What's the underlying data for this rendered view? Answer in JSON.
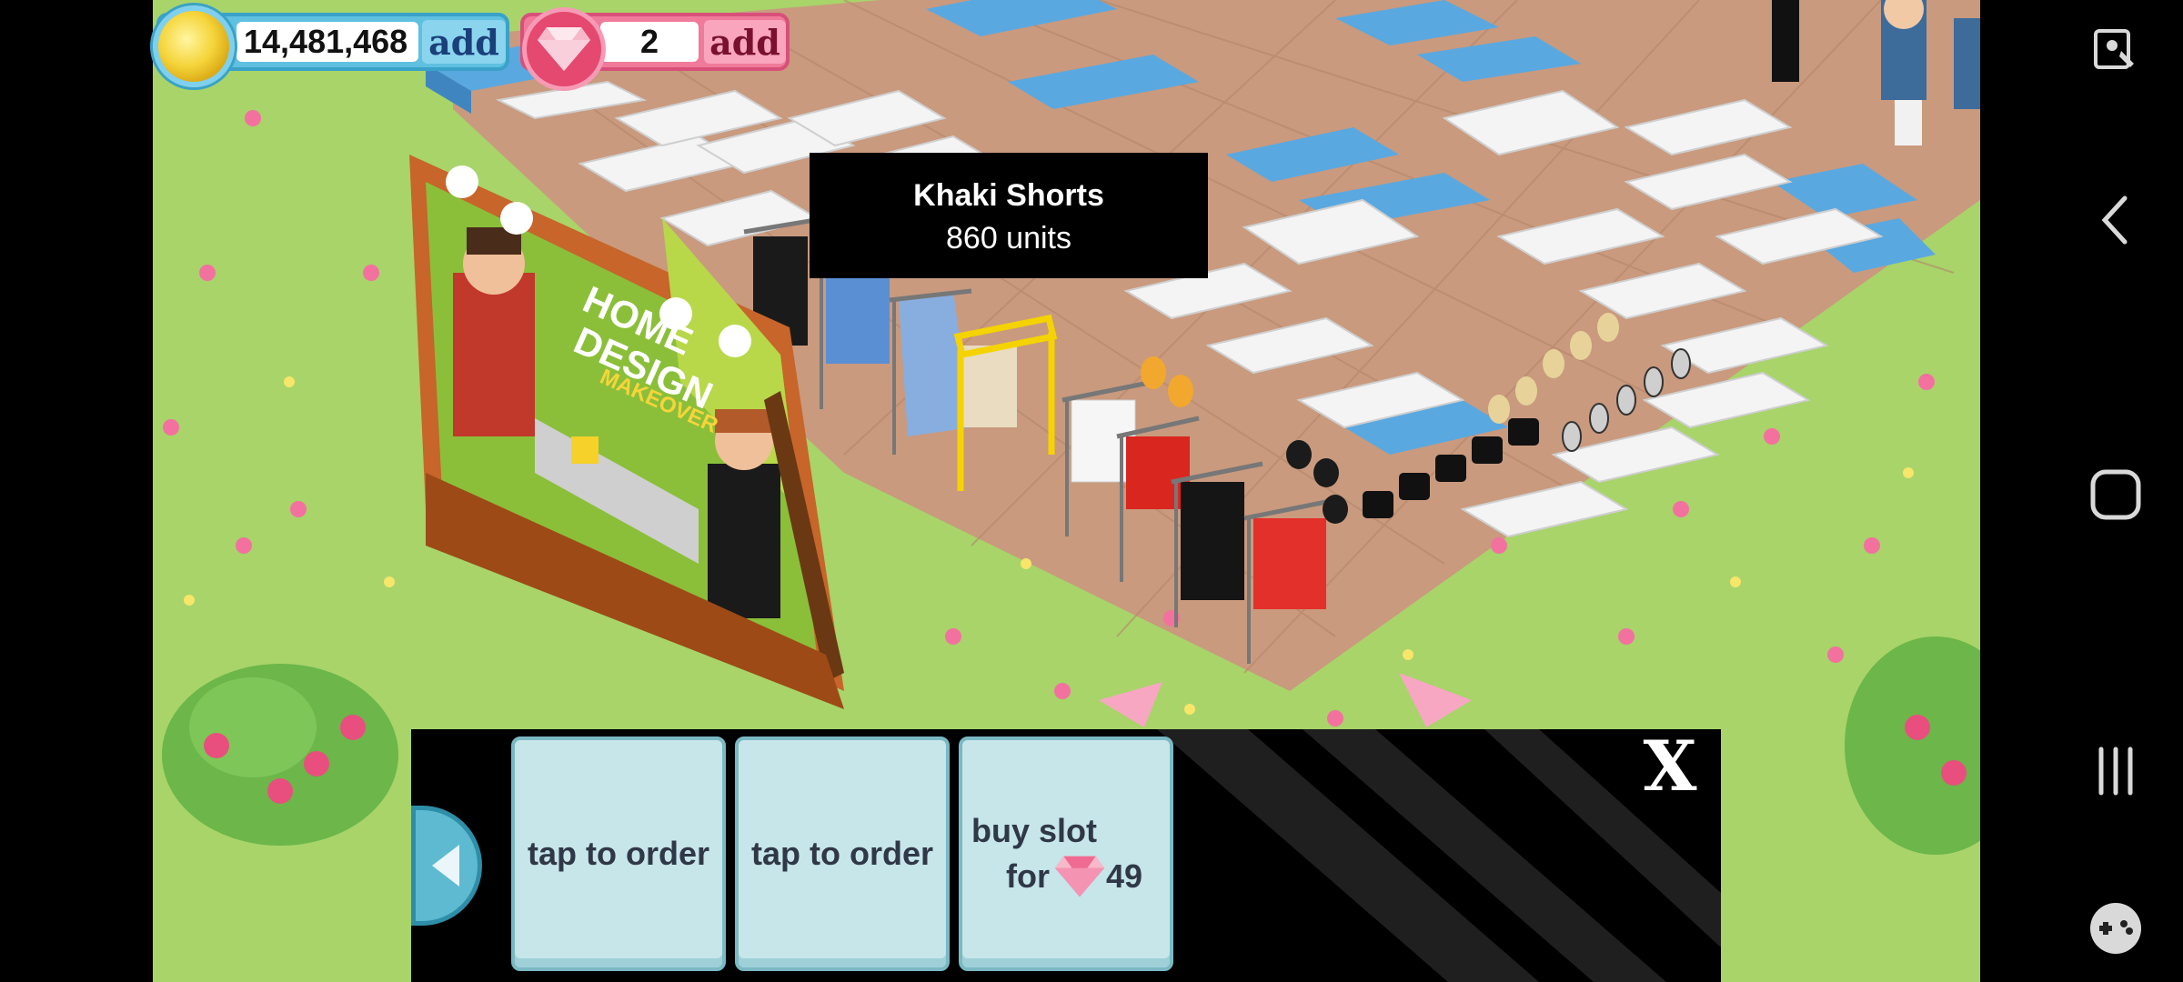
{
  "hud": {
    "coins": "14,481,468",
    "coins_add_label": "add",
    "gems": "2",
    "gems_add_label": "add",
    "coin_icon": "coin-icon",
    "gem_icon": "diamond-icon"
  },
  "tooltip": {
    "title": "Khaki Shorts",
    "subtitle": "860 units"
  },
  "billboard": {
    "line1": "HOME",
    "line2": "DESIGN",
    "line3": "MAKEOVER"
  },
  "order_panel": {
    "slot1_label": "tap to order",
    "slot2_label": "tap to order",
    "slot3_line1": "buy slot",
    "slot3_prefix": "for",
    "slot3_price": "49",
    "close_label": "X"
  },
  "nav": {
    "icons": [
      "screen-recorder-icon",
      "back-icon",
      "home-icon",
      "recents-icon",
      "game-launcher-icon"
    ]
  },
  "colors": {
    "grass": "#a8d46a",
    "floor": "#c99a7e",
    "slot": "#c6e6ea",
    "coin_pill": "#5fc0e0",
    "gem_pill": "#f07a9a"
  }
}
